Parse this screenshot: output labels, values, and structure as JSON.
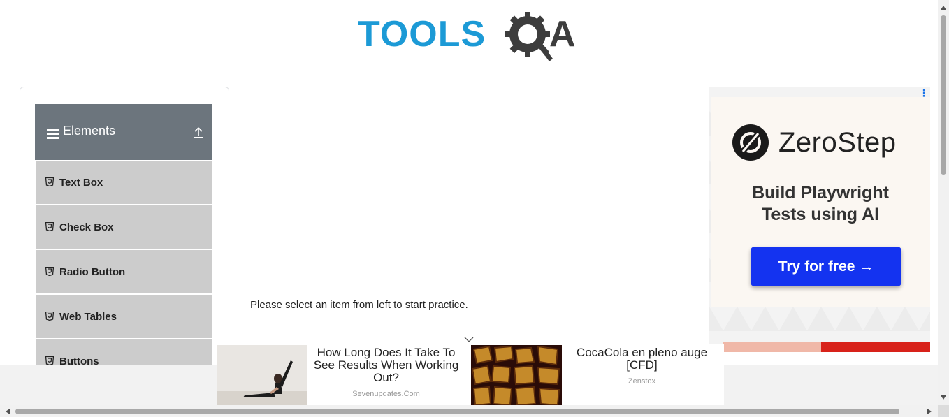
{
  "header": {
    "logo_text_left": "TOOLS",
    "logo_text_right": "A",
    "logo_colors": {
      "primary": "#1c9ad6",
      "secondary": "#3d3d3d"
    }
  },
  "sidebar": {
    "group_title": "Elements",
    "header_color": "#6c757d",
    "items": [
      {
        "label": "Text Box",
        "icon": "html5-icon"
      },
      {
        "label": "Check Box",
        "icon": "html5-icon"
      },
      {
        "label": "Radio Button",
        "icon": "html5-icon"
      },
      {
        "label": "Web Tables",
        "icon": "html5-icon"
      },
      {
        "label": "Buttons",
        "icon": "html5-icon"
      }
    ]
  },
  "main": {
    "instruction": "Please select an item from left to start practice."
  },
  "side_ad": {
    "brand": "ZeroStep",
    "tagline_line1": "Build Playwright",
    "tagline_line2": "Tests using AI",
    "cta_label": "Try for free →",
    "cta_color": "#1433f0"
  },
  "bottom_ads": [
    {
      "headline": "How Long Does It Take To See Results When Working Out?",
      "source": "Sevenupdates.Com"
    },
    {
      "headline": "CocaCola en pleno auge [CFD]",
      "source": "Zenstox"
    }
  ]
}
